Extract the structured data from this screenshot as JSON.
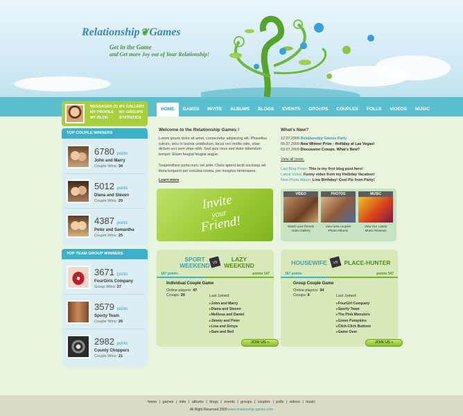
{
  "header": {
    "logo_left": "Relationship",
    "logo_right": "Games",
    "slogan_line1": "Get in the Game",
    "slogan_line2": "and Get more Joy out of Your Relationship!"
  },
  "nav": [
    "HOME",
    "GAMES",
    "INVITE",
    "ALBUMS",
    "BLOGS",
    "EVENTS",
    "GROUPS",
    "COUPLES",
    "POLLS",
    "VIDEOS",
    "MUSIC"
  ],
  "user_links": [
    "MESSAGES (3)",
    "MY GALLERY",
    "MY PROFILE",
    "MY GROUPS",
    "MY BLOG",
    "STATISTICS"
  ],
  "couple_winners": {
    "title": "TOP COUPLE WINNERS",
    "items": [
      {
        "points": "6780",
        "points_label": "points",
        "name": "John and Marry",
        "wins_label": "Couple Wins:",
        "wins": "34"
      },
      {
        "points": "5012",
        "points_label": "points",
        "name": "Diana and Steven",
        "wins_label": "Couple Wins:",
        "wins": "29"
      },
      {
        "points": "4387",
        "points_label": "points",
        "name": "Peter and Samantha",
        "wins_label": "Couple Wins:",
        "wins": "25"
      }
    ]
  },
  "group_winners": {
    "title": "TOP TEAM GROUP WINNERS",
    "items": [
      {
        "points": "3671",
        "points_label": "points",
        "name": "FourGirls Company",
        "wins_label": "Group Wins:",
        "wins": "27"
      },
      {
        "points": "3579",
        "points_label": "points",
        "name": "Sporty Team",
        "wins_label": "Couple Wins:",
        "wins": "26"
      },
      {
        "points": "2982",
        "points_label": "points",
        "name": "County Choppers",
        "wins_label": "Couple Wins:",
        "wins": "21"
      }
    ]
  },
  "welcome": {
    "title": "Welcome to the Relationship Games !",
    "p1": "Lorem ipsum dolor sit amet, consectetur adipiscing elit. Phasellus rutrum, arcu in lacinia vestibulum, lacus orci mollis odio, vitae dictum orci sem vitae nibh. Sed quis risus sed dolor bibendum tempor. Etiam feugiat feugiat augue.",
    "p2": "Suspendisse porta nunc vel ante. Class aptent taciti sociosqu ad litora torquent per conubia nostra, per inceptos himenaeos.",
    "learn_more": "Learn more"
  },
  "news": {
    "title": "What’s New?",
    "items": [
      {
        "date": "12.07.2009",
        "text": "Relationship Games Party",
        "highlight": true
      },
      {
        "date": "05.07.2009",
        "text": "New Winner Prize - Holliday at Las Vegas!",
        "highlight": false
      },
      {
        "date": "03.07.2009",
        "text": "Discussion Croups. What’s New?",
        "highlight": false
      }
    ],
    "view_all": "View all news.",
    "blog_lines": [
      {
        "label": "Last Blog Posts:",
        "text": "This is my first blog post here!"
      },
      {
        "label": "Latest Video:",
        "text": "Funny video from my Holliday Vacation!"
      },
      {
        "label": "New Photo Album:",
        "text": "Lina Birthday! Cool Pix from Party!"
      }
    ]
  },
  "invite": {
    "line1": "Invite",
    "line2": "your",
    "line3": "Friend!"
  },
  "media": [
    {
      "title": "VIDEO",
      "desc1": "Watch your friends",
      "desc2": "Video Gallery"
    },
    {
      "title": "PHOTOS",
      "desc1": "View new couples",
      "desc2": "Photo Albums"
    },
    {
      "title": "MUSIC",
      "desc1": "View Our Latest",
      "desc2": "Music Reviews"
    }
  ],
  "games": [
    {
      "left_l1": "SPORT",
      "left_l2": "WEEKEND",
      "right_l1": "LAZY",
      "right_l2": "WEEKEND",
      "vs": "VS",
      "left_points": "187 points",
      "right_points": "points 147",
      "type": "Individual Couple Game",
      "players_label": "Online players:",
      "players": "47",
      "groups_label": "Croups:",
      "groups": "20",
      "last_joined": "Last Joined:",
      "joined": [
        "John and Marry",
        "Diana and Steven",
        "Mellissa and Daniel",
        "Jimmy and Peter",
        "Lisa and Sonya",
        "Sam and Neil"
      ],
      "join": "JOIN US »"
    },
    {
      "left_l1": "HOUSEWIFE",
      "left_l2": "",
      "right_l1": "PLACE-HUNTER",
      "right_l2": "",
      "vs": "VS",
      "left_points": "187 points",
      "right_points": "points 347",
      "type": "Group Couple Game",
      "players_label": "Online players:",
      "players": "34",
      "groups_label": "Croups:",
      "groups": "6",
      "last_joined": "Last Joined:",
      "joined": [
        "FourGirl Company",
        "Sporty Team",
        "The Pink Monsters",
        "Green Pumpkins",
        "Click-Click Buttons",
        "Game Over"
      ],
      "join": "JOIN US »"
    }
  ],
  "footer": {
    "links": [
      "home",
      "games",
      "inite",
      "albums",
      "blogs",
      "events",
      "groups",
      "couples",
      "polls",
      "videos",
      "music"
    ],
    "copyright": "All Right Reserved 2009",
    "url": "www.relationship-games.com"
  },
  "colors": {
    "accent": "#3cb1c9",
    "green": "#a7cf3c",
    "bg": "#e9f4df"
  }
}
